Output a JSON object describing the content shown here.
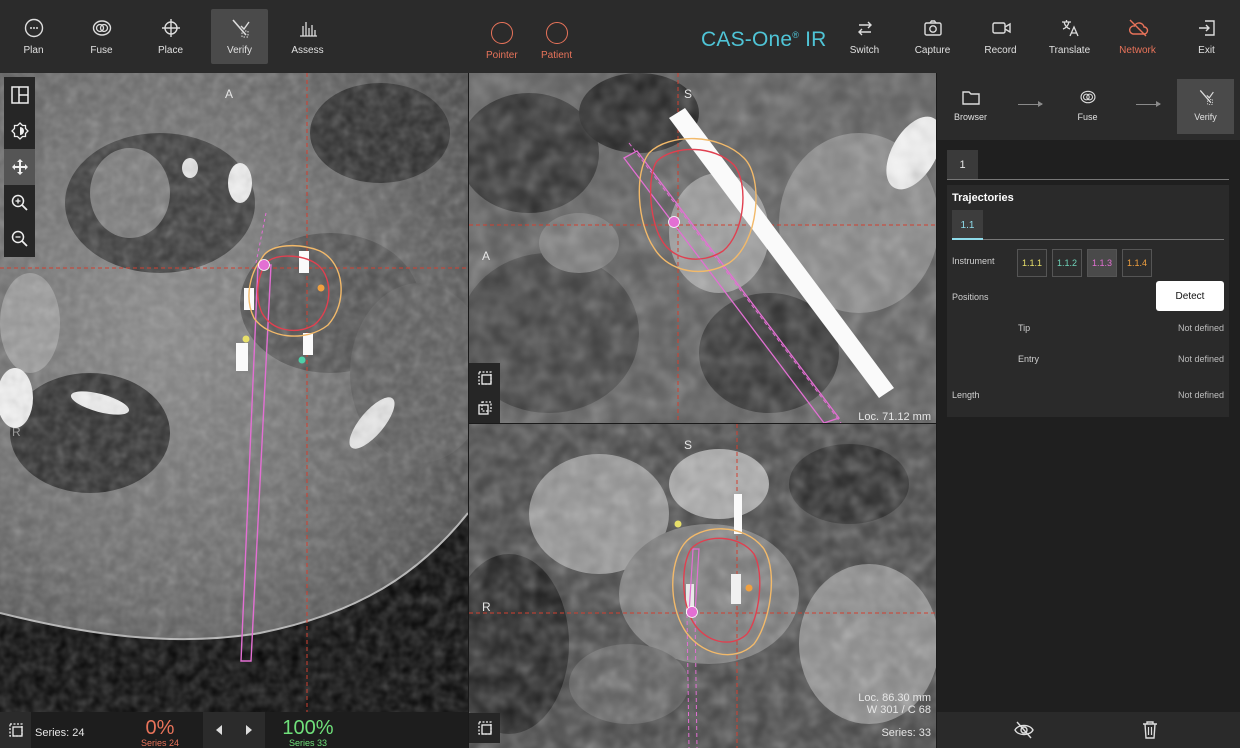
{
  "toolbar": {
    "left": [
      {
        "label": "Plan",
        "icon": "plan-icon"
      },
      {
        "label": "Fuse",
        "icon": "fuse-icon"
      },
      {
        "label": "Place",
        "icon": "place-icon"
      },
      {
        "label": "Verify",
        "icon": "verify-icon",
        "active": true
      },
      {
        "label": "Assess",
        "icon": "assess-icon"
      }
    ],
    "center": [
      {
        "label": "Pointer",
        "icon": "pointer-status-icon"
      },
      {
        "label": "Patient",
        "icon": "patient-status-icon"
      }
    ],
    "brand": "CAS-One",
    "brand_mark": "®",
    "brand_suffix": " IR",
    "right": [
      {
        "label": "Switch",
        "icon": "switch-icon"
      },
      {
        "label": "Capture",
        "icon": "camera-icon"
      },
      {
        "label": "Record",
        "icon": "video-icon"
      },
      {
        "label": "Translate",
        "icon": "translate-icon"
      },
      {
        "label": "Network",
        "icon": "cloud-off-icon",
        "alert": true
      },
      {
        "label": "Exit",
        "icon": "exit-icon"
      }
    ],
    "colors": {
      "accent": "#4fc4d6",
      "alert": "#e8735a"
    }
  },
  "views": {
    "axial": {
      "top": "A",
      "left": "R"
    },
    "sagittal": {
      "top": "S",
      "left": "A",
      "loc": "Loc. 71.12 mm"
    },
    "coronal": {
      "top": "S",
      "left": "R",
      "loc": "Loc. 86.30 mm",
      "wc": "W 301 / C 68",
      "series": "Series: 33"
    }
  },
  "bottom": {
    "series": "Series: 24",
    "left_pct": "0%",
    "left_series": "Series 24",
    "right_pct": "100%",
    "right_series": "Series 33",
    "left_color": "#e8735a",
    "right_color": "#6fe07a"
  },
  "panel": {
    "workflow": [
      {
        "label": "Browser",
        "icon": "folder-icon"
      },
      {
        "label": "Fuse",
        "icon": "fuse-icon"
      },
      {
        "label": "Verify",
        "icon": "verify-icon",
        "active": true
      }
    ],
    "tab": "1",
    "trajectories_title": "Trajectories",
    "subtab": "1.1",
    "instrument_label": "Instrument",
    "instruments": [
      {
        "label": "1.1.1",
        "color": "#e8e06a"
      },
      {
        "label": "1.1.2",
        "color": "#6fd3b8"
      },
      {
        "label": "1.1.3",
        "color": "#e36fd3",
        "selected": true
      },
      {
        "label": "1.1.4",
        "color": "#f0a040"
      }
    ],
    "positions_label": "Positions",
    "detect_label": "Detect",
    "tip_label": "Tip",
    "tip_value": "Not defined",
    "entry_label": "Entry",
    "entry_value": "Not defined",
    "length_label": "Length",
    "length_value": "Not defined"
  }
}
